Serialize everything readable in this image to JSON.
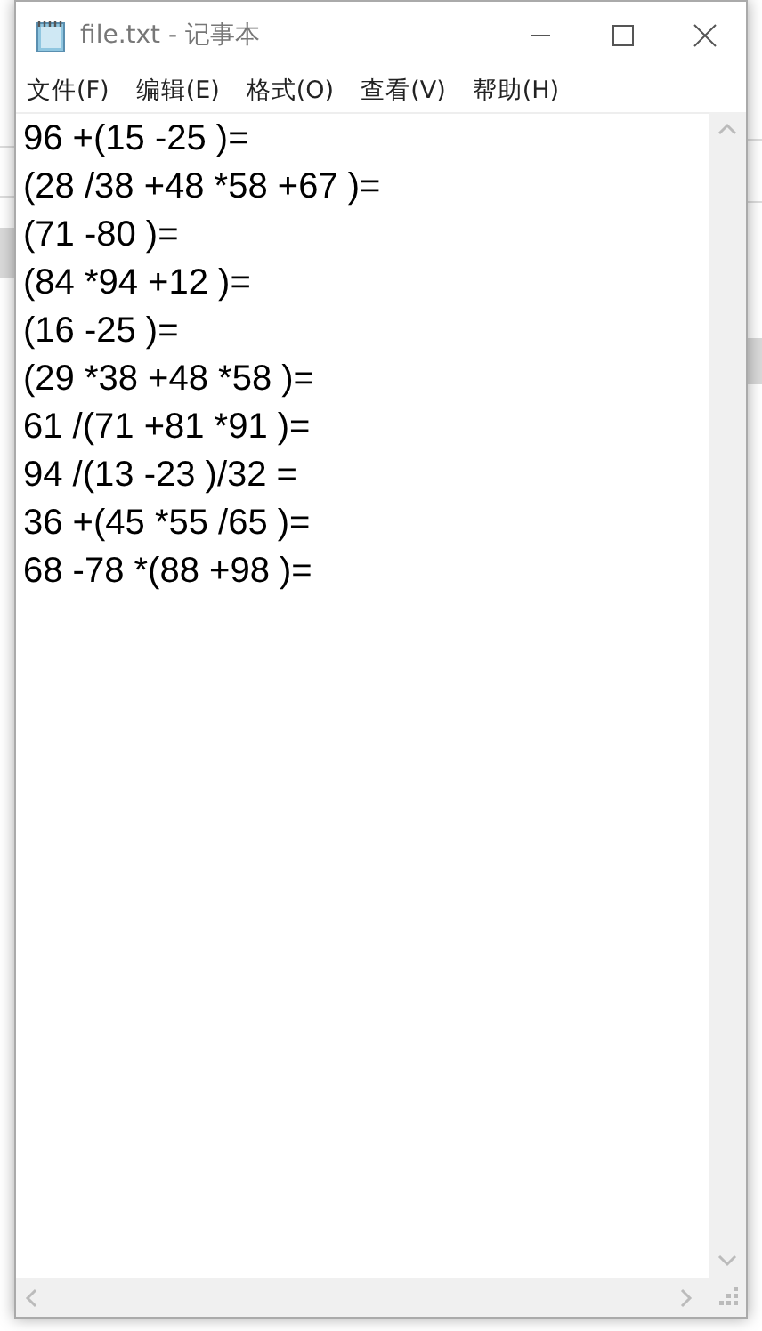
{
  "window": {
    "title": "file.txt - 记事本"
  },
  "menu": [
    "文件(F)",
    "编辑(E)",
    "格式(O)",
    "查看(V)",
    "帮助(H)"
  ],
  "lines": [
    "96 +(15 -25 )=",
    "(28 /38 +48 *58 +67 )=",
    "(71 -80 )=",
    "(84 *94 +12 )=",
    "(16 -25 )=",
    "(29 *38 +48 *58 )=",
    "61 /(71 +81 *91 )=",
    "94 /(13 -23 )/32 =",
    "36 +(45 *55 /65 )=",
    "68 -78 *(88 +98 )="
  ]
}
